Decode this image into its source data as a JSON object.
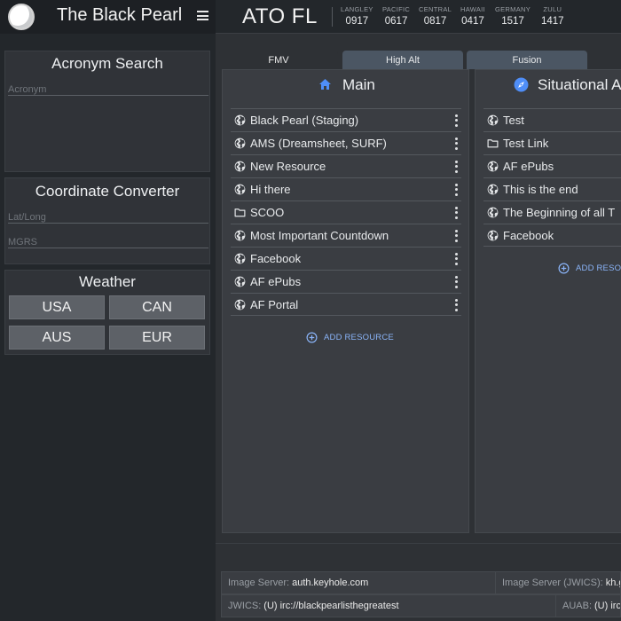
{
  "app": {
    "title": "The Black Pearl"
  },
  "sidebar": {
    "acronym": {
      "title": "Acronym Search",
      "placeholder": "Acronym"
    },
    "coordinate": {
      "title": "Coordinate Converter",
      "latlong_placeholder": "Lat/Long",
      "mgrs_placeholder": "MGRS"
    },
    "weather": {
      "title": "Weather",
      "buttons": [
        "USA",
        "CAN",
        "AUS",
        "EUR"
      ]
    }
  },
  "header": {
    "title": "ATO FL",
    "clocks": [
      {
        "label": "LANGLEY",
        "time": "0917"
      },
      {
        "label": "PACIFIC",
        "time": "0617"
      },
      {
        "label": "CENTRAL",
        "time": "0817"
      },
      {
        "label": "HAWAII",
        "time": "0417"
      },
      {
        "label": "GERMANY",
        "time": "1517"
      },
      {
        "label": "ZULU",
        "time": "1417"
      }
    ]
  },
  "tabs": [
    "FMV",
    "High Alt",
    "Fusion"
  ],
  "boards": {
    "main": {
      "title": "Main",
      "icon": "home-icon",
      "items": [
        {
          "label": "Black Pearl (Staging)",
          "icon": "globe-icon"
        },
        {
          "label": "AMS (Dreamsheet, SURF)",
          "icon": "globe-icon"
        },
        {
          "label": "New Resource",
          "icon": "globe-icon"
        },
        {
          "label": "Hi there",
          "icon": "globe-icon"
        },
        {
          "label": "SCOO",
          "icon": "folder-icon"
        },
        {
          "label": "Most Important Countdown",
          "icon": "globe-icon"
        },
        {
          "label": "Facebook",
          "icon": "globe-icon"
        },
        {
          "label": "AF ePubs",
          "icon": "globe-icon"
        },
        {
          "label": "AF Portal",
          "icon": "globe-icon"
        }
      ],
      "add_label": "ADD RESOURCE"
    },
    "situational": {
      "title": "Situational A",
      "icon": "compass-icon",
      "items": [
        {
          "label": "Test",
          "icon": "globe-icon"
        },
        {
          "label": "Test Link",
          "icon": "folder-icon"
        },
        {
          "label": "AF ePubs",
          "icon": "globe-icon"
        },
        {
          "label": "This is the end",
          "icon": "globe-icon"
        },
        {
          "label": "The Beginning of all T",
          "icon": "globe-icon"
        },
        {
          "label": "Facebook",
          "icon": "globe-icon"
        }
      ],
      "add_label": "ADD RESOU"
    }
  },
  "footer": {
    "image_server": {
      "key": "Image Server:",
      "value": "auth.keyhole.com"
    },
    "image_server_jwics": {
      "key": "Image Server (JWICS):",
      "value": "kh.g"
    },
    "jwics": {
      "key": "JWICS:",
      "value": "(U) irc://blackpearlisthegreatest"
    },
    "auab": {
      "key": "AUAB:",
      "value": "(U) irc"
    }
  },
  "colors": {
    "accent": "#8ab4f8",
    "icon_blue": "#4f8ef7",
    "inactive_tab": "#4b5663"
  }
}
